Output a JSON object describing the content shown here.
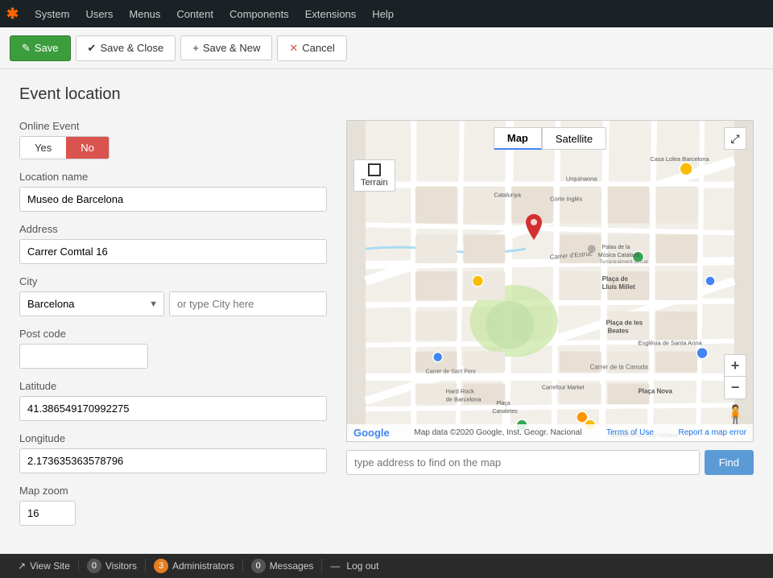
{
  "nav": {
    "logo": "☰",
    "items": [
      "System",
      "Users",
      "Menus",
      "Content",
      "Components",
      "Extensions",
      "Help"
    ]
  },
  "toolbar": {
    "save_label": "Save",
    "save_close_label": "Save & Close",
    "save_new_label": "Save & New",
    "cancel_label": "Cancel"
  },
  "page": {
    "title": "Event location"
  },
  "form": {
    "online_event_label": "Online Event",
    "yes_label": "Yes",
    "no_label": "No",
    "location_name_label": "Location name",
    "location_name_value": "Museo de Barcelona",
    "address_label": "Address",
    "address_value": "Carrer Comtal 16",
    "city_label": "City",
    "city_select_value": "Barcelona",
    "city_type_placeholder": "or type City here",
    "postcode_label": "Post code",
    "postcode_value": "",
    "latitude_label": "Latitude",
    "latitude_value": "41.386549170992275",
    "longitude_label": "Longitude",
    "longitude_value": "2.173635363578796",
    "map_zoom_label": "Map zoom",
    "map_zoom_value": "16"
  },
  "map": {
    "tab_map": "Map",
    "tab_satellite": "Satellite",
    "terrain_label": "Terrain",
    "fullscreen_icon": "⤢",
    "zoom_in_icon": "+",
    "zoom_out_icon": "−",
    "pegman_icon": "🧍",
    "footer_data": "Map data ©2020 Google, Inst. Geogr. Nacional",
    "footer_terms": "Terms of Use",
    "footer_error": "Report a map error",
    "google_logo": "Google"
  },
  "find": {
    "placeholder": "type address to find on the map",
    "button_label": "Find"
  },
  "status_bar": {
    "view_site_label": "View Site",
    "visitors_label": "Visitors",
    "visitors_count": "0",
    "admins_label": "Administrators",
    "admins_count": "3",
    "messages_label": "Messages",
    "messages_count": "0",
    "logout_label": "Log out"
  }
}
